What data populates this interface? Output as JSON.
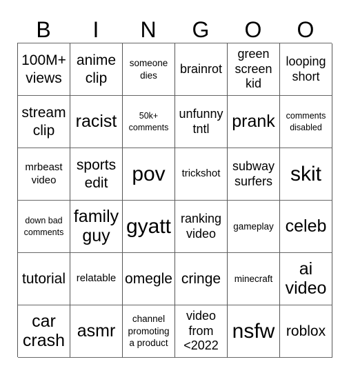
{
  "header": {
    "letters": [
      "B",
      "I",
      "N",
      "G",
      "O",
      "O"
    ]
  },
  "board": {
    "rows": [
      [
        {
          "text": "100M+ views",
          "size": "md"
        },
        {
          "text": "anime clip",
          "size": "md"
        },
        {
          "text": "someone dies",
          "size": "xxs"
        },
        {
          "text": "brainrot",
          "size": "sm"
        },
        {
          "text": "green screen kid",
          "size": "sm"
        },
        {
          "text": "looping short",
          "size": "sm"
        }
      ],
      [
        {
          "text": "stream clip",
          "size": "md"
        },
        {
          "text": "racist",
          "size": "lg"
        },
        {
          "text": "50k+ comments",
          "size": "tiny"
        },
        {
          "text": "unfunny tntl",
          "size": "sm"
        },
        {
          "text": "prank",
          "size": "lg"
        },
        {
          "text": "comments disabled",
          "size": "tiny"
        }
      ],
      [
        {
          "text": "mrbeast video",
          "size": "xs"
        },
        {
          "text": "sports edit",
          "size": "md"
        },
        {
          "text": "pov",
          "size": "xl"
        },
        {
          "text": "trickshot",
          "size": "xs"
        },
        {
          "text": "subway surfers",
          "size": "sm"
        },
        {
          "text": "skit",
          "size": "xl"
        }
      ],
      [
        {
          "text": "down bad comments",
          "size": "tiny"
        },
        {
          "text": "family guy",
          "size": "lg"
        },
        {
          "text": "gyatt",
          "size": "xl"
        },
        {
          "text": "ranking video",
          "size": "sm"
        },
        {
          "text": "gameplay",
          "size": "xxs"
        },
        {
          "text": "celeb",
          "size": "lg"
        }
      ],
      [
        {
          "text": "tutorial",
          "size": "md"
        },
        {
          "text": "relatable",
          "size": "xs"
        },
        {
          "text": "omegle",
          "size": "md"
        },
        {
          "text": "cringe",
          "size": "md"
        },
        {
          "text": "minecraft",
          "size": "xxs"
        },
        {
          "text": "ai video",
          "size": "lg"
        }
      ],
      [
        {
          "text": "car crash",
          "size": "lg"
        },
        {
          "text": "asmr",
          "size": "lg"
        },
        {
          "text": "channel promoting a product",
          "size": "xxs"
        },
        {
          "text": "video from <2022",
          "size": "sm"
        },
        {
          "text": "nsfw",
          "size": "xl"
        },
        {
          "text": "roblox",
          "size": "md"
        }
      ]
    ]
  }
}
